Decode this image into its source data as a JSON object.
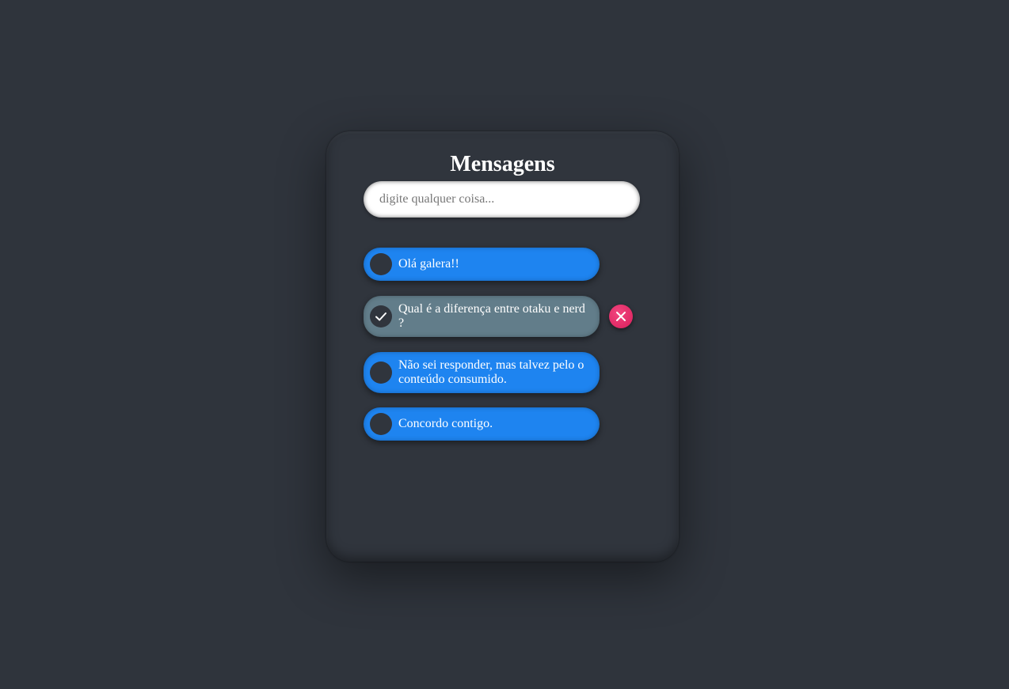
{
  "header": {
    "title": "Mensagens"
  },
  "input": {
    "placeholder": "digite qualquer coisa...",
    "value": ""
  },
  "messages": [
    {
      "text": "Olá galera!!",
      "done": false
    },
    {
      "text": "Qual é a diferença entre otaku e nerd ?",
      "done": true
    },
    {
      "text": "Não sei responder, mas talvez pelo o conteúdo consumido.",
      "done": false
    },
    {
      "text": "Concordo contigo.",
      "done": false
    }
  ],
  "icons": {
    "check": "check-icon",
    "delete": "close-icon"
  },
  "colors": {
    "background": "#2f343c",
    "message": "#1e84f0",
    "message_done": "#627d8a",
    "delete": "#e2336f",
    "title": "#ffffff"
  }
}
